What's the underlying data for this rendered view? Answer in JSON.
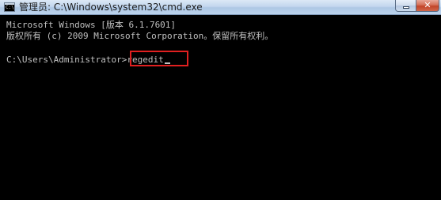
{
  "window": {
    "title": "管理员: C:\\Windows\\system32\\cmd.exe",
    "icon": "cmd-console-icon",
    "icon_text": "C:\\",
    "minimize_icon": "minimize-icon",
    "close_icon": "close-icon",
    "close_glyph": "✕"
  },
  "console": {
    "lines": [
      "Microsoft Windows [版本 6.1.7601]",
      "版权所有 (c) 2009 Microsoft Corporation。保留所有权利。"
    ],
    "prompt": "C:\\Users\\Administrator>",
    "command": "regedit",
    "text_color": "#c0c0c0",
    "background": "#000000",
    "highlight_color": "#e02020"
  }
}
